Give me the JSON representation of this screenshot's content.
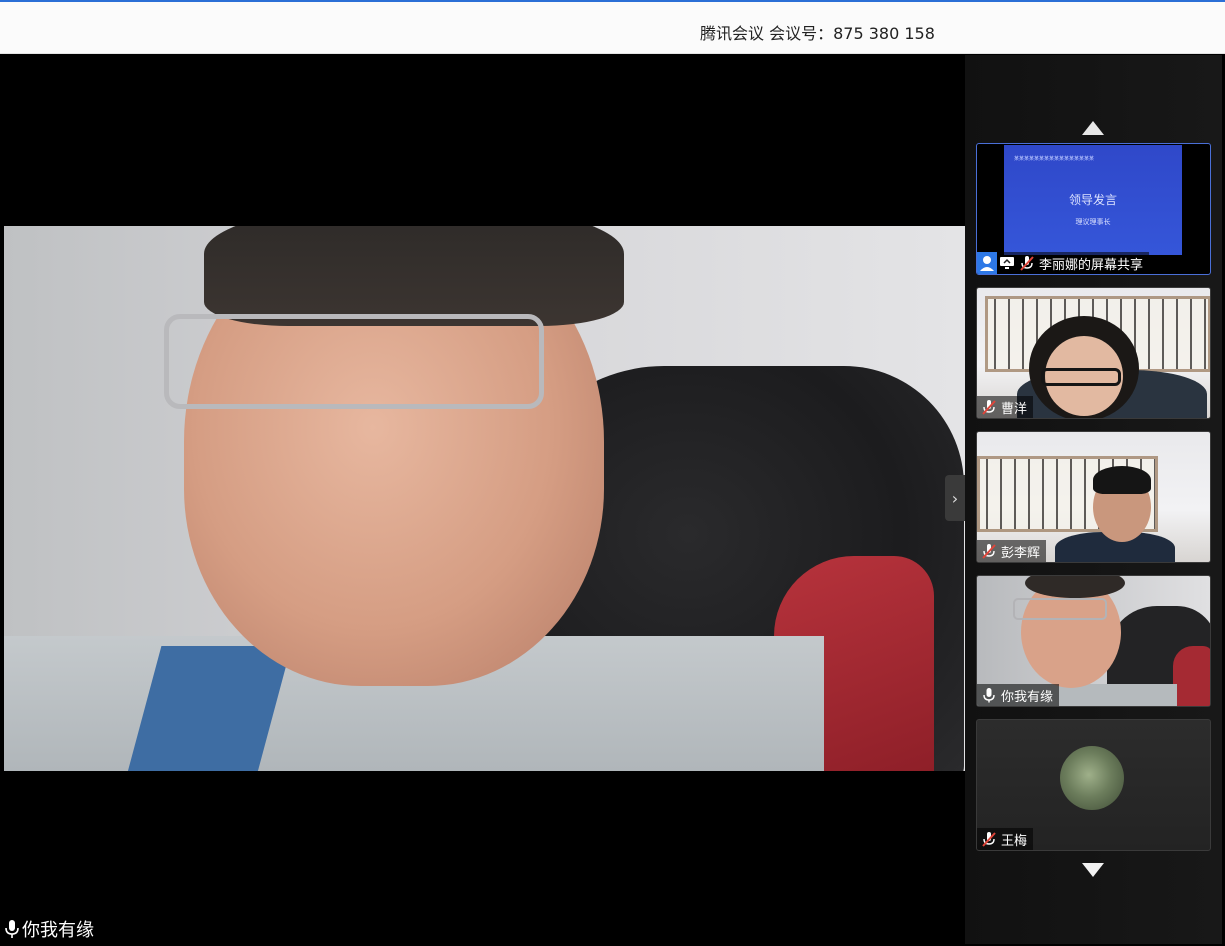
{
  "window": {
    "title": "腾讯会议 会议号：875 380 158"
  },
  "main_video": {
    "speaker_name": "你我有缘"
  },
  "participants": [
    {
      "name": "李丽娜的屏幕共享",
      "type": "screen-share",
      "mic": "muted",
      "slide": {
        "top_text": "某某某某某某某某某某某某某某某某",
        "title": "领导发言",
        "subtitle": "理议理事长"
      }
    },
    {
      "name": "曹洋",
      "type": "video",
      "mic": "muted"
    },
    {
      "name": "彭李辉",
      "type": "video",
      "mic": "muted"
    },
    {
      "name": "你我有缘",
      "type": "video",
      "mic": "on"
    },
    {
      "name": "王梅",
      "type": "avatar",
      "mic": "muted"
    }
  ],
  "colors": {
    "accent": "#2b6fd6",
    "muted_mic": "#e0453a",
    "share_slide": "#3556d9"
  },
  "icons": {
    "scroll_up": "triangle-up-icon",
    "scroll_down": "triangle-down-icon",
    "collapse": "chevron-right-icon"
  }
}
